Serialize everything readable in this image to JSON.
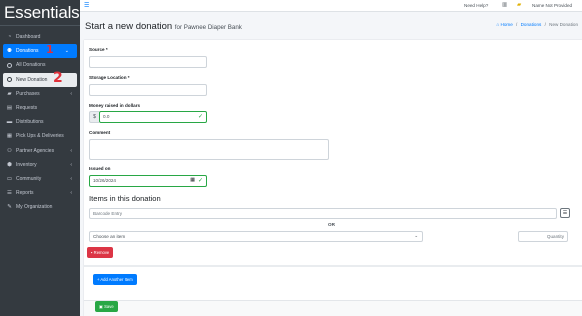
{
  "brand": "Essentials",
  "topbar": {
    "menu_icon": "hamburger-icon",
    "help": "Need Help?",
    "user": "Name Not Provided"
  },
  "sidebar": {
    "items": [
      {
        "label": "Dashboard",
        "icon": "dashboard-icon"
      },
      {
        "label": "Donations",
        "icon": "donations-icon",
        "active": true
      },
      {
        "label": "All Donations",
        "sub": true
      },
      {
        "label": "New Donation",
        "sub": true,
        "current": true
      },
      {
        "label": "Purchases",
        "icon": "cart-icon"
      },
      {
        "label": "Requests",
        "icon": "file-icon"
      },
      {
        "label": "Distributions",
        "icon": "truck-icon"
      },
      {
        "label": "Pick Ups & Deliveries",
        "icon": "calendar-icon"
      },
      {
        "label": "Partner Agencies",
        "icon": "users-icon"
      },
      {
        "label": "Inventory",
        "icon": "warehouse-icon"
      },
      {
        "label": "Community",
        "icon": "community-icon"
      },
      {
        "label": "Reports",
        "icon": "reports-icon"
      },
      {
        "label": "My Organization",
        "icon": "wrench-icon"
      }
    ],
    "markers": {
      "donations": "1",
      "new_donation": "2"
    }
  },
  "page": {
    "title": "Start a new donation",
    "subtitle": "for Pawnee Diaper Bank",
    "breadcrumb": {
      "home": "Home",
      "donations": "Donations",
      "current": "New Donation",
      "separator": "/"
    }
  },
  "form": {
    "source_label": "Source *",
    "storage_label": "Storage Location *",
    "money_label": "Money raised in dollars",
    "money_prefix": "$",
    "money_value": "0.0",
    "comment_label": "Comment",
    "issued_label": "Issued on",
    "issued_value": "10/26/2024",
    "items_title": "Items in this donation",
    "barcode_placeholder": "Barcode Entry",
    "or": "OR",
    "item_select": "Choose an item",
    "quantity_placeholder": "Quantity",
    "remove": "Remove",
    "add_another": "Add Another Item",
    "save": "Save"
  },
  "colors": {
    "sidebar": "#343a40",
    "primary": "#007bff",
    "success": "#28a745",
    "danger": "#dc3545",
    "marker": "#e0303a"
  }
}
